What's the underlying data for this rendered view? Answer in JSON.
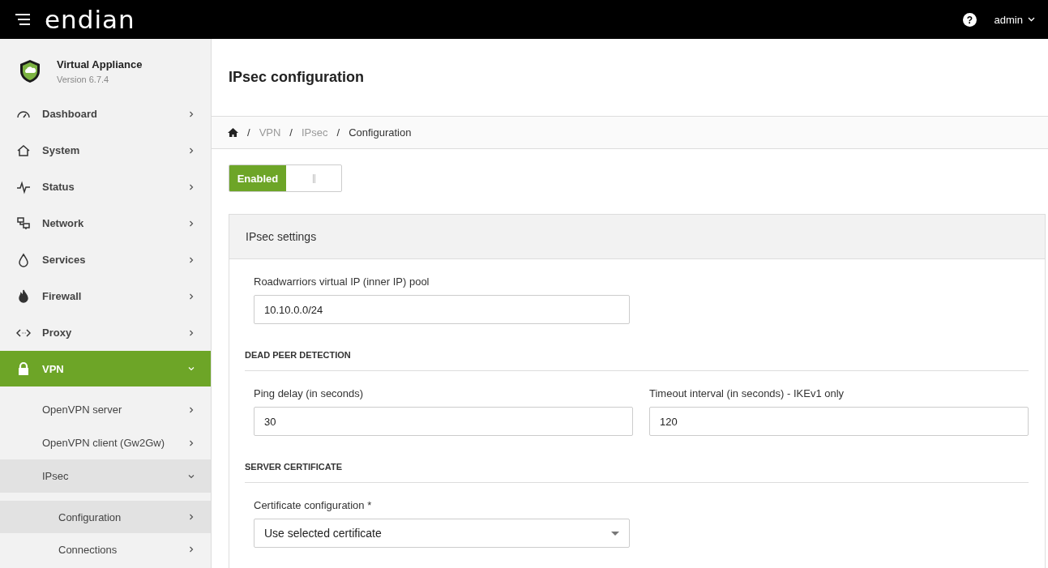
{
  "topbar": {
    "logo": "endian",
    "help": "?",
    "user": "admin"
  },
  "appliance": {
    "name": "Virtual Appliance",
    "version": "Version 6.7.4"
  },
  "sidebar": {
    "items": [
      {
        "label": "Dashboard",
        "selected": false,
        "expanded": false
      },
      {
        "label": "System",
        "selected": false,
        "expanded": false
      },
      {
        "label": "Status",
        "selected": false,
        "expanded": false
      },
      {
        "label": "Network",
        "selected": false,
        "expanded": false
      },
      {
        "label": "Services",
        "selected": false,
        "expanded": false
      },
      {
        "label": "Firewall",
        "selected": false,
        "expanded": false
      },
      {
        "label": "Proxy",
        "selected": false,
        "expanded": false
      },
      {
        "label": "VPN",
        "selected": true,
        "expanded": true,
        "children": [
          {
            "label": "OpenVPN server",
            "expanded": false
          },
          {
            "label": "OpenVPN client (Gw2Gw)",
            "expanded": false
          },
          {
            "label": "IPsec",
            "expanded": true,
            "children": [
              {
                "label": "Configuration",
                "selected": true
              },
              {
                "label": "Connections",
                "selected": false
              }
            ]
          }
        ]
      }
    ]
  },
  "page": {
    "title": "IPsec configuration"
  },
  "breadcrumb": [
    {
      "sep": "/",
      "label": "VPN"
    },
    {
      "sep": "/",
      "label": "IPsec"
    },
    {
      "sep": "/",
      "label": "Configuration"
    }
  ],
  "toggle": {
    "label": "Enabled",
    "on": true
  },
  "panel": {
    "title": "IPsec settings",
    "pool": {
      "label": "Roadwarriors virtual IP (inner IP) pool",
      "value": "10.10.0.0/24"
    },
    "dpd": {
      "heading": "DEAD PEER DETECTION",
      "fields": [
        {
          "label": "Ping delay (in seconds)",
          "value": "30"
        },
        {
          "label": "Timeout interval (in seconds) - IKEv1 only",
          "value": "120"
        }
      ]
    },
    "cert": {
      "heading": "SERVER CERTIFICATE",
      "label": "Certificate configuration *",
      "value": "Use selected certificate"
    }
  }
}
